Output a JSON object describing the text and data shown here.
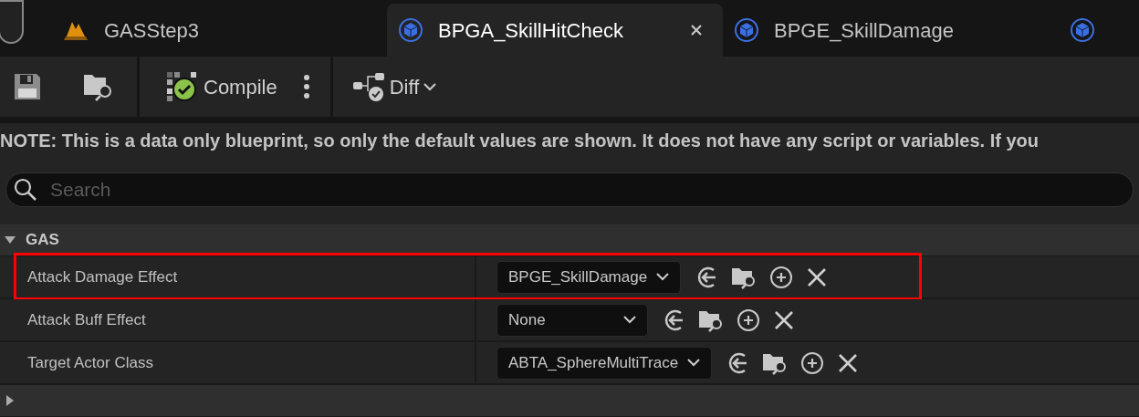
{
  "tabs": [
    {
      "label": "GASStep3",
      "kind": "level",
      "selected": false
    },
    {
      "label": "BPGA_SkillHitCheck",
      "kind": "blueprint",
      "selected": true,
      "closable": true
    },
    {
      "label": "BPGE_SkillDamage",
      "kind": "blueprint",
      "selected": false
    },
    {
      "kind": "blueprint",
      "selected": false
    }
  ],
  "toolbar": {
    "compile": "Compile",
    "diff": "Diff"
  },
  "note": "NOTE: This is a data only blueprint, so only the default values are shown.  It does not have any script or variables.  If you",
  "search": {
    "placeholder": "Search"
  },
  "categories": [
    {
      "name": "GAS",
      "expanded": true,
      "properties": [
        {
          "label": "Attack Damage Effect",
          "value": "BPGE_SkillDamage",
          "highlighted": true
        },
        {
          "label": "Attack Buff Effect",
          "value": "None",
          "highlighted": false
        },
        {
          "label": "Target Actor Class",
          "value": "ABTA_SphereMultiTrace",
          "highlighted": false
        }
      ]
    },
    {
      "expanded": false
    }
  ]
}
